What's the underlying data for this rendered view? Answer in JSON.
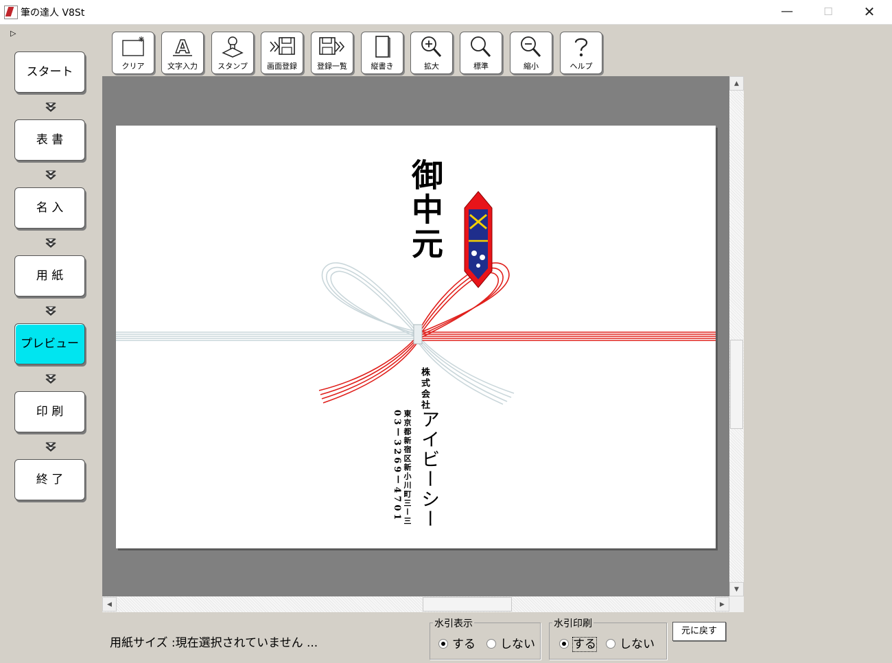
{
  "window": {
    "title": "筆の達人 V8St",
    "minimize": "—",
    "maximize": "☐",
    "close": "✕"
  },
  "sidebar": {
    "collapse_glyph": "▷",
    "steps": [
      {
        "label": "スタート",
        "active": false
      },
      {
        "label": "表 書",
        "active": false
      },
      {
        "label": "名 入",
        "active": false
      },
      {
        "label": "用 紙",
        "active": false
      },
      {
        "label": "プレビュー",
        "active": true
      },
      {
        "label": "印 刷",
        "active": false
      },
      {
        "label": "終 了",
        "active": false
      }
    ]
  },
  "toolbar": {
    "buttons": [
      {
        "label": "クリア",
        "icon": "clear-icon"
      },
      {
        "label": "文字入力",
        "icon": "text-input-icon"
      },
      {
        "label": "スタンプ",
        "icon": "stamp-icon"
      },
      {
        "label": "画面登録",
        "icon": "save-screen-icon"
      },
      {
        "label": "登録一覧",
        "icon": "saved-list-icon"
      },
      {
        "label": "縦書き",
        "icon": "vertical-writing-icon"
      },
      {
        "label": "拡大",
        "icon": "zoom-in-icon"
      },
      {
        "label": "標準",
        "icon": "zoom-standard-icon"
      },
      {
        "label": "縮小",
        "icon": "zoom-out-icon"
      },
      {
        "label": "ヘルプ",
        "icon": "help-icon"
      }
    ]
  },
  "preview": {
    "omote": "御中元",
    "company_type": "株式会社",
    "company_name": "アイビーシー",
    "address": "東京都新宿区新小川町三ー三",
    "phone": "03ー3269ー4701",
    "colors": {
      "mizuhiki_red": "#e0201c",
      "mizuhiki_silver": "#c9d6da",
      "noshi_red": "#e8141a",
      "noshi_blue": "#1f2e8c",
      "noshi_yellow": "#f5d000"
    }
  },
  "status": {
    "paper_size": "用紙サイズ :現在選択されていません  ...",
    "watermark_display": {
      "legend": "水引表示",
      "option_yes": "する",
      "option_no": "しない",
      "selected": "する"
    },
    "watermark_print": {
      "legend": "水引印刷",
      "option_yes": "する",
      "option_no": "しない",
      "selected": "する"
    },
    "reset_button": "元に戻す"
  }
}
